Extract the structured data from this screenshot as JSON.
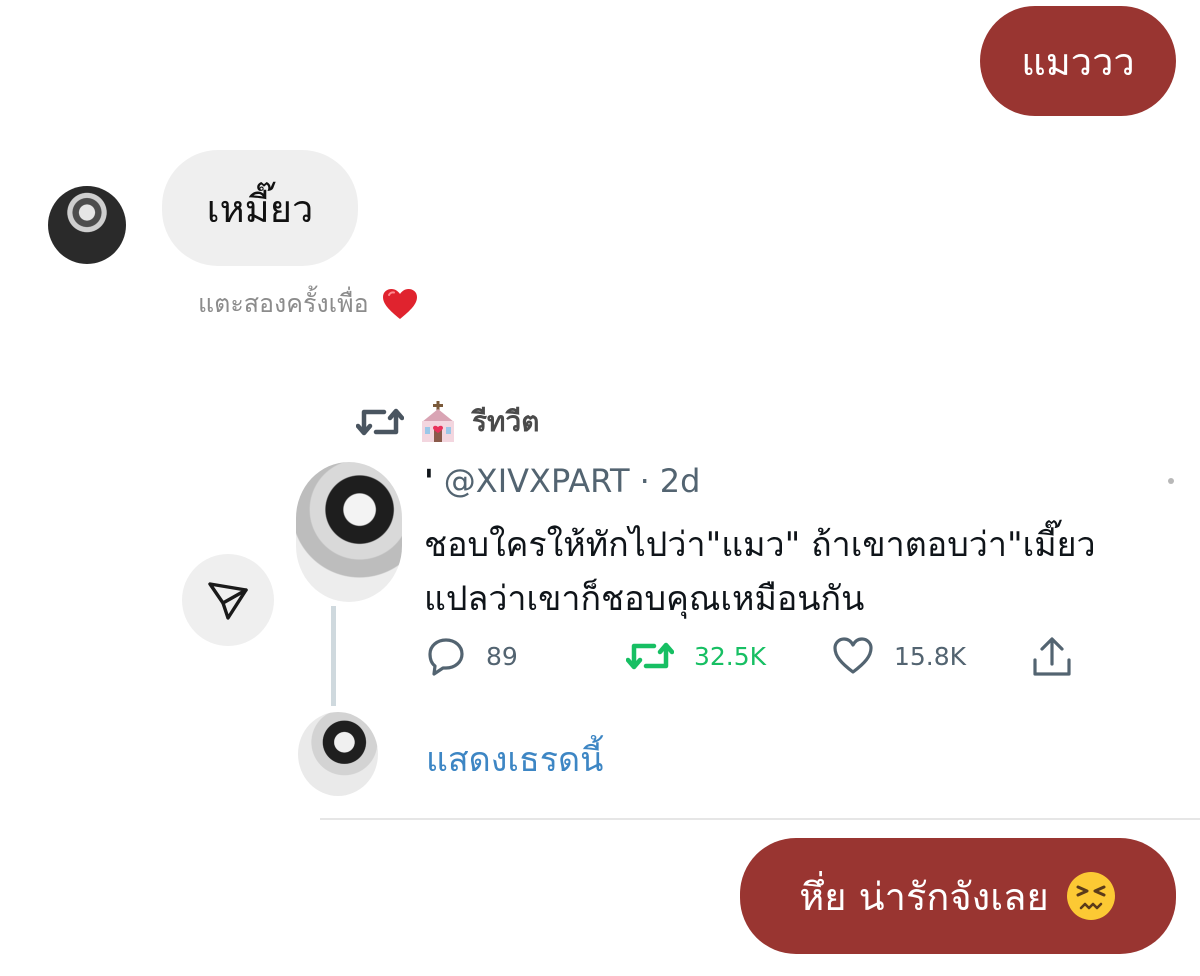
{
  "messages": {
    "outgoing_1": "แมววว",
    "incoming_1": "เหมี๊ยว",
    "reaction_hint": "แตะสองครั้งเพื่อ",
    "reaction_icon": "heart-emoji",
    "outgoing_2": "หึ่ย น่ารักจังเลย",
    "outgoing_2_icon": "persevering-face-emoji"
  },
  "shared_tweet": {
    "retweet_label": "รีทวีต",
    "header_icon": "church-emoji",
    "name_mark": "'",
    "handle": "@XIVXPART",
    "separator": "·",
    "age": "2d",
    "text_line_1": "ชอบใครให้ทักไปว่า\"แมว\" ถ้าเขาตอบว่า\"เมี๊ยว",
    "text_line_2": "แปลว่าเขาก็ชอบคุณเหมือนกัน",
    "replies": "89",
    "retweets": "32.5K",
    "likes": "15.8K",
    "show_thread": "แสดงเธรดนี้"
  },
  "colors": {
    "outgoing_bubble": "#993531",
    "incoming_bubble": "#efefef",
    "retweet_green": "#17bf63",
    "link_blue": "#3d86c4"
  }
}
